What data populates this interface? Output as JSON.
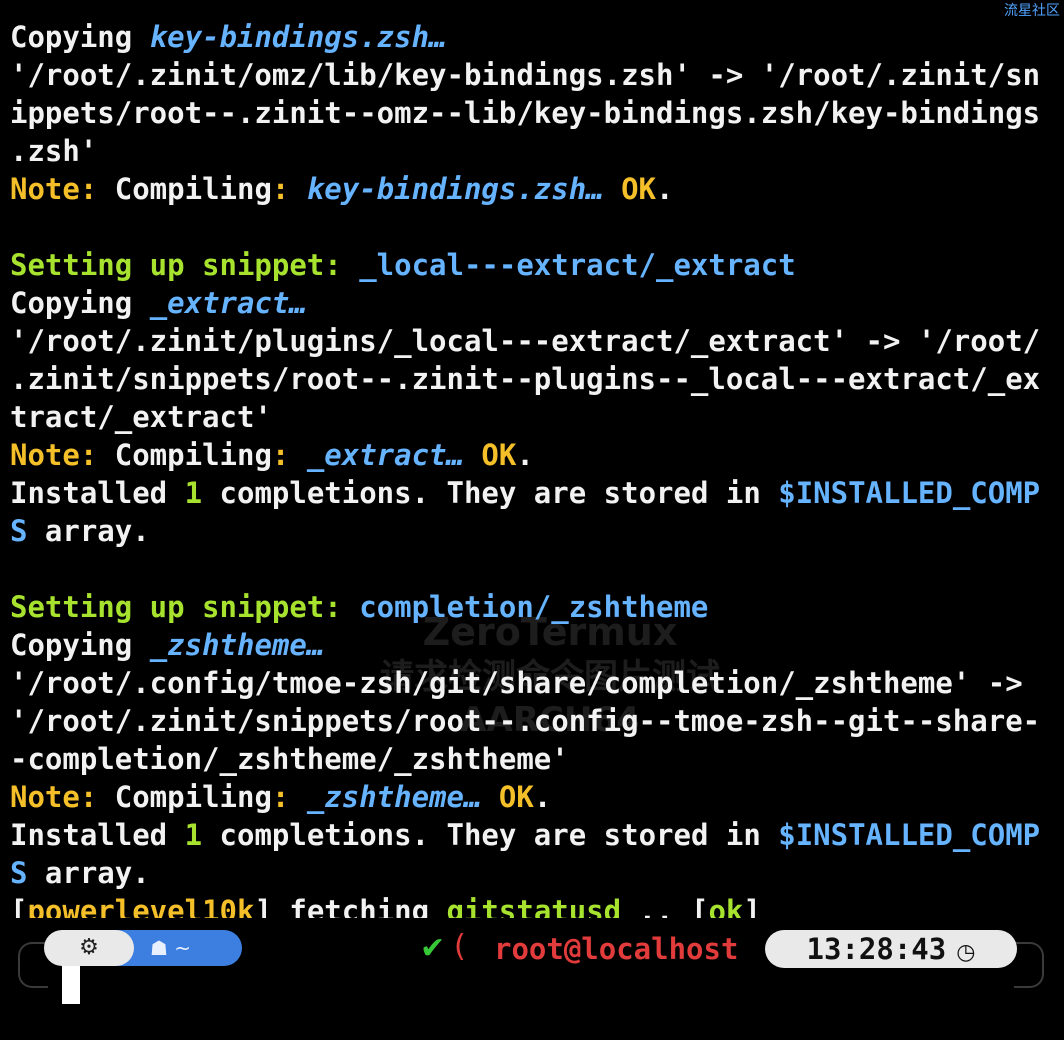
{
  "corner_mark": "流星社区",
  "watermark": {
    "line1": "ZeroTermux",
    "line2": "请求检测命令图片测试",
    "line3": "AARCH64"
  },
  "lines": [
    {
      "segments": [
        {
          "text": "Copying ",
          "color": "white"
        },
        {
          "text": "key-bindings.zsh…",
          "color": "blue-i"
        }
      ]
    },
    {
      "segments": [
        {
          "text": "'/root/.zinit/omz/lib/key-bindings.zsh' -> '/root/.zinit/sn",
          "color": "white"
        }
      ]
    },
    {
      "segments": [
        {
          "text": "ippets/root--.zinit--omz--lib/key-bindings.zsh/key-bindings",
          "color": "white"
        }
      ]
    },
    {
      "segments": [
        {
          "text": ".zsh'",
          "color": "white"
        }
      ]
    },
    {
      "segments": [
        {
          "text": "Note: ",
          "color": "yellow"
        },
        {
          "text": "Compiling",
          "color": "white"
        },
        {
          "text": ": ",
          "color": "yellow"
        },
        {
          "text": "key-bindings.zsh…",
          "color": "blue-i"
        },
        {
          "text": " OK",
          "color": "yellow"
        },
        {
          "text": ".",
          "color": "white"
        }
      ]
    },
    {
      "segments": [
        {
          "text": " ",
          "color": "white"
        }
      ]
    },
    {
      "segments": [
        {
          "text": "Setting up snippet: ",
          "color": "green"
        },
        {
          "text": "_local---extract/_extract",
          "color": "blue"
        }
      ]
    },
    {
      "segments": [
        {
          "text": "Copying ",
          "color": "white"
        },
        {
          "text": "_extract…",
          "color": "blue-i"
        }
      ]
    },
    {
      "segments": [
        {
          "text": "'/root/.zinit/plugins/_local---extract/_extract' -> '/root/",
          "color": "white"
        }
      ]
    },
    {
      "segments": [
        {
          "text": ".zinit/snippets/root--.zinit--plugins--_local---extract/_ex",
          "color": "white"
        }
      ]
    },
    {
      "segments": [
        {
          "text": "tract/_extract'",
          "color": "white"
        }
      ]
    },
    {
      "segments": [
        {
          "text": "Note: ",
          "color": "yellow"
        },
        {
          "text": "Compiling",
          "color": "white"
        },
        {
          "text": ": ",
          "color": "yellow"
        },
        {
          "text": "_extract…",
          "color": "blue-i"
        },
        {
          "text": " OK",
          "color": "yellow"
        },
        {
          "text": ".",
          "color": "white"
        }
      ]
    },
    {
      "segments": [
        {
          "text": "Installed ",
          "color": "white"
        },
        {
          "text": "1",
          "color": "green"
        },
        {
          "text": " completions. They are stored in ",
          "color": "white"
        },
        {
          "text": "$INSTALLED_COMP",
          "color": "blue"
        }
      ]
    },
    {
      "segments": [
        {
          "text": "S",
          "color": "blue"
        },
        {
          "text": " array.",
          "color": "white"
        }
      ]
    },
    {
      "segments": [
        {
          "text": " ",
          "color": "white"
        }
      ]
    },
    {
      "segments": [
        {
          "text": "Setting up snippet: ",
          "color": "green"
        },
        {
          "text": "completion/_zshtheme",
          "color": "blue"
        }
      ]
    },
    {
      "segments": [
        {
          "text": "Copying ",
          "color": "white"
        },
        {
          "text": "_zshtheme…",
          "color": "blue-i"
        }
      ]
    },
    {
      "segments": [
        {
          "text": "'/root/.config/tmoe-zsh/git/share/completion/_zshtheme' ->",
          "color": "white"
        }
      ]
    },
    {
      "segments": [
        {
          "text": "'/root/.zinit/snippets/root--.config--tmoe-zsh--git--share-",
          "color": "white"
        }
      ]
    },
    {
      "segments": [
        {
          "text": "-completion/_zshtheme/_zshtheme'",
          "color": "white"
        }
      ]
    },
    {
      "segments": [
        {
          "text": "Note: ",
          "color": "yellow"
        },
        {
          "text": "Compiling",
          "color": "white"
        },
        {
          "text": ": ",
          "color": "yellow"
        },
        {
          "text": "_zshtheme…",
          "color": "blue-i"
        },
        {
          "text": " OK",
          "color": "yellow"
        },
        {
          "text": ".",
          "color": "white"
        }
      ]
    },
    {
      "segments": [
        {
          "text": "Installed ",
          "color": "white"
        },
        {
          "text": "1",
          "color": "green"
        },
        {
          "text": " completions. They are stored in ",
          "color": "white"
        },
        {
          "text": "$INSTALLED_COMP",
          "color": "blue"
        }
      ]
    },
    {
      "segments": [
        {
          "text": "S",
          "color": "blue"
        },
        {
          "text": " array.",
          "color": "white"
        }
      ]
    },
    {
      "segments": [
        {
          "text": "[",
          "color": "white"
        },
        {
          "text": "powerlevel10k",
          "color": "yellow"
        },
        {
          "text": "] fetching ",
          "color": "white"
        },
        {
          "text": "gitstatusd",
          "color": "green"
        },
        {
          "text": " .. [",
          "color": "white"
        },
        {
          "text": "ok",
          "color": "green"
        },
        {
          "text": "]",
          "color": "white"
        }
      ]
    }
  ],
  "prompt": {
    "os_icon": "⚙",
    "home_icon": "☗",
    "dir": "~",
    "status": "✔",
    "separator": "(",
    "host": "root@localhost",
    "time": "13:28:43",
    "clock_icon": "◷"
  },
  "colors": {
    "background": "#000000",
    "green": "#a6e22e",
    "yellow": "#f4bf29",
    "blue": "#66b3ff",
    "red": "#e23b3b",
    "dir_segment": "#3d7fe0"
  }
}
